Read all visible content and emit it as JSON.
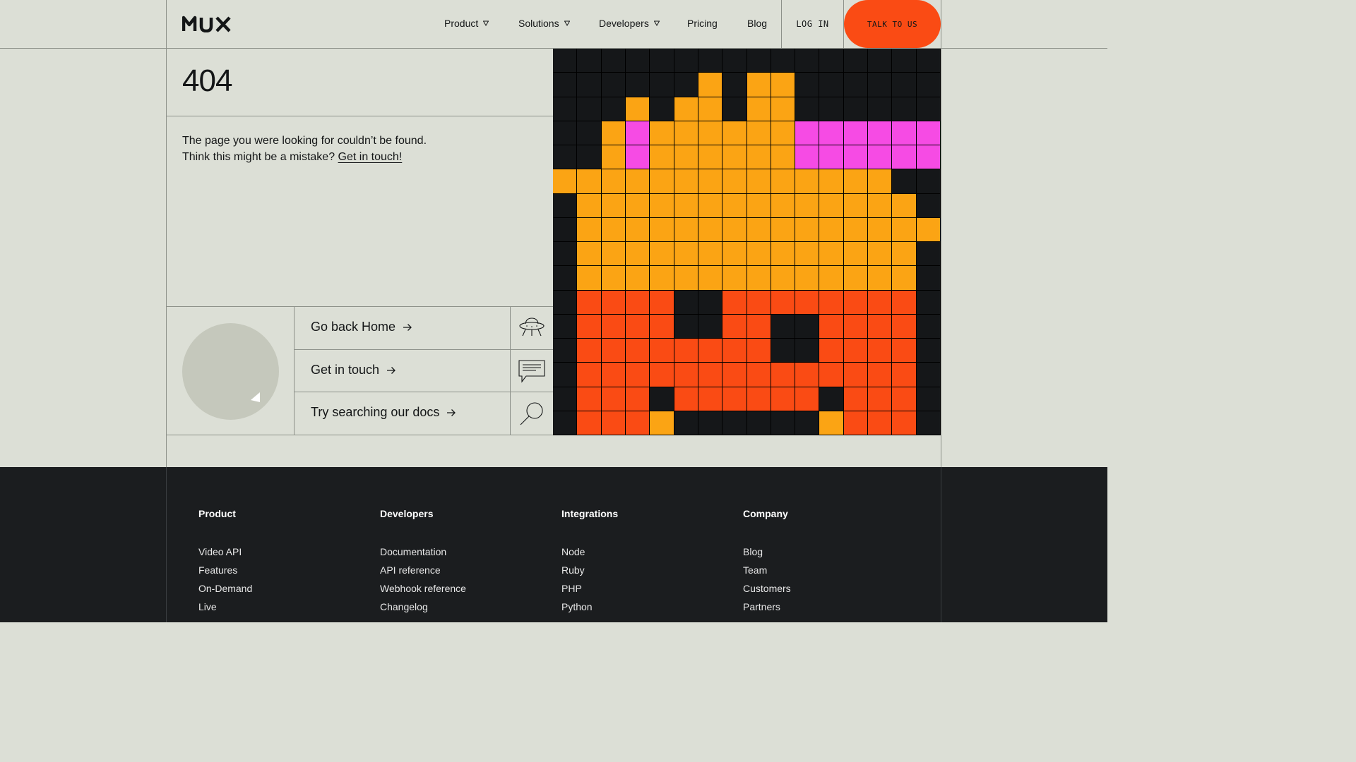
{
  "header": {
    "logo": "MUX",
    "nav": [
      {
        "label": "Product",
        "dropdown": true
      },
      {
        "label": "Solutions",
        "dropdown": true
      },
      {
        "label": "Developers",
        "dropdown": true
      },
      {
        "label": "Pricing",
        "dropdown": false
      },
      {
        "label": "Blog",
        "dropdown": false
      }
    ],
    "login": "LOG IN",
    "cta": "TALK TO US"
  },
  "main": {
    "code": "404",
    "message_line1": "The page you were looking for couldn’t be found.",
    "message_line2_prefix": "Think this might be a mistake? ",
    "message_link": "Get in touch!",
    "actions": [
      {
        "label": "Go back Home",
        "icon": "ufo-icon"
      },
      {
        "label": "Get in touch",
        "icon": "chat-bubble-icon"
      },
      {
        "label": "Try searching our docs",
        "icon": "magnifier-icon"
      }
    ]
  },
  "colors": {
    "bg": "#dcdfd6",
    "black": "#151719",
    "orange": "#fba414",
    "red": "#fa4b14",
    "pink": "#f64be4"
  },
  "pixel_grid": [
    "KKKKKKKKKKKKKKKK",
    "KKKKKKOKOOKKKKKK",
    "KKKOKOOKOOKKKKKK",
    "KKOPOOOOOOPPPPPP",
    "KKOPOOOOOOPPPPPP",
    "OOOOOOOOOOOOOOKK",
    "KOOOOOOOOOOOOOOK",
    "KOOOOOOOOOOOOOOO",
    "KOOOOOOOOOOOOOOK",
    "KOOOOOOOOOOOOOOK",
    "KRRRRKKRRRRRRRRK",
    "KRRRRKKRRKKRRRRK",
    "KRRRRRRRRKKRRRRK",
    "KRRRRRRRRRRRRRRK",
    "KRRRKRRRRRRKRRRK",
    "KRRROKKKKKKORRRK"
  ],
  "footer": {
    "columns": [
      {
        "title": "Product",
        "links": [
          "Video API",
          "Features",
          "On-Demand",
          "Live"
        ]
      },
      {
        "title": "Developers",
        "links": [
          "Documentation",
          "API reference",
          "Webhook reference",
          "Changelog"
        ]
      },
      {
        "title": "Integrations",
        "links": [
          "Node",
          "Ruby",
          "PHP",
          "Python"
        ]
      },
      {
        "title": "Company",
        "links": [
          "Blog",
          "Team",
          "Customers",
          "Partners"
        ]
      }
    ]
  }
}
